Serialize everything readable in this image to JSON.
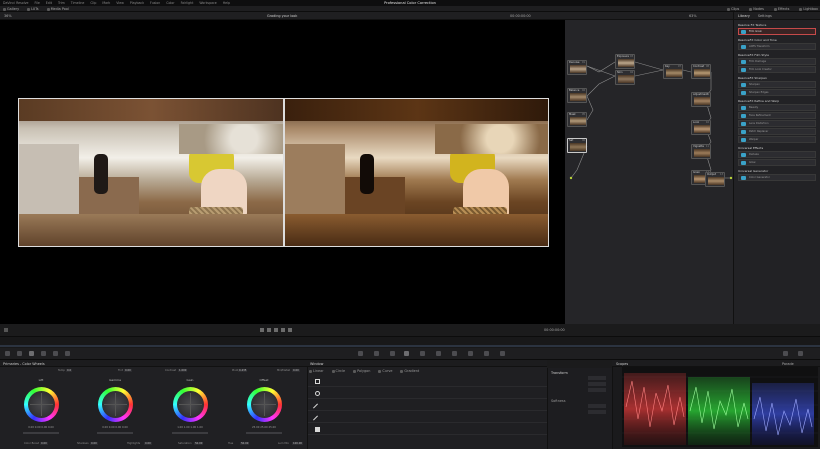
{
  "app": {
    "title": "Professional Color Correction",
    "project_name": "Grading your look"
  },
  "menubar": [
    "DaVinci Resolve",
    "File",
    "Edit",
    "Trim",
    "Timeline",
    "Clip",
    "Mark",
    "View",
    "Playback",
    "Fusion",
    "Color",
    "Fairlight",
    "Workspace",
    "Help"
  ],
  "toolbar": {
    "left": [
      "Gallery",
      "LUTs",
      "Media Pool"
    ],
    "right": [
      "Clips",
      "Nodes",
      "Effects",
      "Lightbox"
    ]
  },
  "viewer": {
    "zoom": "36%",
    "timecode_top": "00:00:00:00",
    "timecode_bottom": "00:00:00:00",
    "split_mode": "Before | After"
  },
  "nodes": {
    "zoom": "63%",
    "list": [
      {
        "id": "01",
        "label": "Denoise"
      },
      {
        "id": "02",
        "label": "Balance"
      },
      {
        "id": "03",
        "label": "Exposure"
      },
      {
        "id": "04",
        "label": "Skin"
      },
      {
        "id": "05",
        "label": "Mask"
      },
      {
        "id": "06",
        "label": "Sat"
      },
      {
        "id": "07",
        "label": "Key"
      },
      {
        "id": "08",
        "label": "Contrast"
      },
      {
        "id": "09",
        "label": "Adjustment"
      },
      {
        "id": "10",
        "label": "Look"
      },
      {
        "id": "11",
        "label": "Vignette"
      },
      {
        "id": "12",
        "label": "Grain"
      },
      {
        "id": "13",
        "label": "Output"
      }
    ]
  },
  "library": {
    "tabs": [
      "Library",
      "Settings"
    ],
    "categories": [
      {
        "name": "Resolve FX Texture",
        "items": [
          "Film Grain"
        ],
        "selected": 0
      },
      {
        "name": "ResolveFX Color and Tone",
        "items": [
          "ACES Transform"
        ]
      },
      {
        "name": "ResolveFX Film Style",
        "items": [
          "Film Damage",
          "Film Look Creator"
        ]
      },
      {
        "name": "ResolveFX Sharpen",
        "items": [
          "Sharpen",
          "Sharpen Edges"
        ]
      },
      {
        "name": "ResolveFX Refine and Warp",
        "items": [
          "Beauty",
          "Face Refinement",
          "Lens Distortion",
          "Patch Replacer",
          "Warper"
        ]
      },
      {
        "name": "Universal Effects",
        "items": [
          "Dehaze",
          "Glow"
        ]
      },
      {
        "name": "Universal Generator",
        "items": [
          "Color Generator"
        ]
      }
    ]
  },
  "color_wheels": {
    "header": "Primaries - Color Wheels",
    "top_params": [
      {
        "label": "Temp",
        "value": "0.0"
      },
      {
        "label": "Tint",
        "value": "0.00"
      },
      {
        "label": "Contrast",
        "value": "1.000"
      },
      {
        "label": "Pivot",
        "value": "0.435"
      },
      {
        "label": "Mid/Detail",
        "value": "0.00"
      }
    ],
    "wheels": [
      {
        "name": "Lift",
        "values": "0.00  0.00  0.00  0.00"
      },
      {
        "name": "Gamma",
        "values": "0.00  0.00  0.00  0.00"
      },
      {
        "name": "Gain",
        "values": "1.00  1.00  1.00  1.00"
      },
      {
        "name": "Offset",
        "values": "25.00  25.00  25.00"
      }
    ],
    "bottom_params": [
      {
        "label": "Color Boost",
        "value": "0.00"
      },
      {
        "label": "Shadows",
        "value": "0.00"
      },
      {
        "label": "Highlights",
        "value": "0.00"
      },
      {
        "label": "Saturation",
        "value": "50.00"
      },
      {
        "label": "Hue",
        "value": "50.00"
      },
      {
        "label": "Lum Mix",
        "value": "100.00"
      }
    ]
  },
  "window_panel": {
    "header": "Window",
    "tools": [
      "Linear",
      "Circle",
      "Polygon",
      "Curve",
      "Gradient"
    ],
    "shapes": [
      "square-shape",
      "circle-shape",
      "pen-shape",
      "curve-pen-shape",
      "gradient-shape"
    ]
  },
  "transform": {
    "title": "Transform",
    "subtitle": "Softness"
  },
  "scopes": {
    "title": "Scopes",
    "mode": "Parade"
  }
}
